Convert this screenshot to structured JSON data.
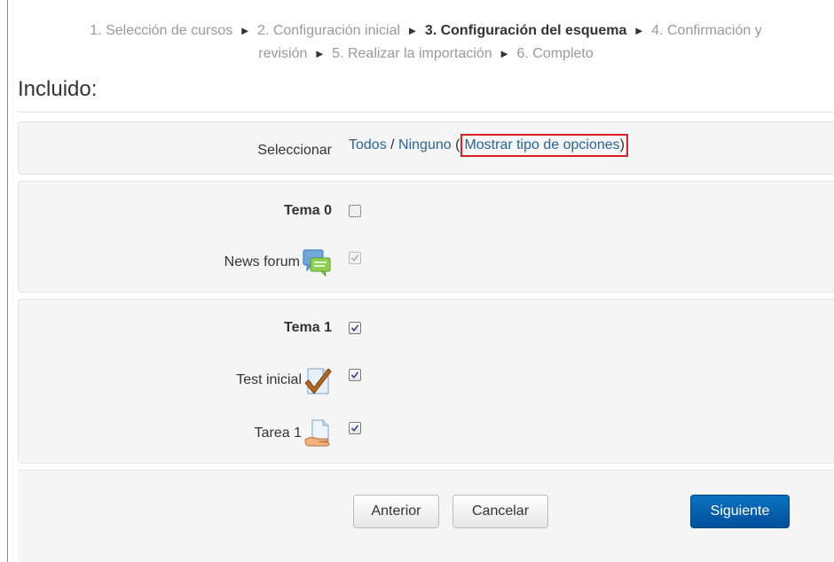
{
  "breadcrumb": {
    "step1": "1. Selección de cursos",
    "step2": "2. Configuración inicial",
    "step3": "3. Configuración del esquema",
    "step4": "4. Confirmación y",
    "step4b": "revisión",
    "step5": "5. Realizar la importación",
    "step6": "6. Completo",
    "separator": "►"
  },
  "heading": "Incluido:",
  "select_row": {
    "label": "Seleccionar",
    "all": "Todos",
    "divider": " / ",
    "none": "Ninguno",
    "open_paren": " (",
    "show_types": "Mostrar tipo de opciones",
    "close_paren": ")"
  },
  "sections": [
    {
      "title": "Tema 0",
      "checked": false,
      "items": [
        {
          "label": "News forum",
          "icon": "forum-icon",
          "checked": true,
          "disabled": true
        }
      ]
    },
    {
      "title": "Tema 1",
      "checked": true,
      "items": [
        {
          "label": "Test inicial",
          "icon": "quiz-icon",
          "checked": true,
          "disabled": false
        },
        {
          "label": "Tarea 1",
          "icon": "assignment-icon",
          "checked": true,
          "disabled": false
        }
      ]
    }
  ],
  "buttons": {
    "previous": "Anterior",
    "cancel": "Cancelar",
    "next": "Siguiente"
  },
  "colors": {
    "link": "#2a6496",
    "highlight_box": "#e02020",
    "primary_button": "#0a5ca8",
    "panel_bg": "#f5f5f5"
  }
}
